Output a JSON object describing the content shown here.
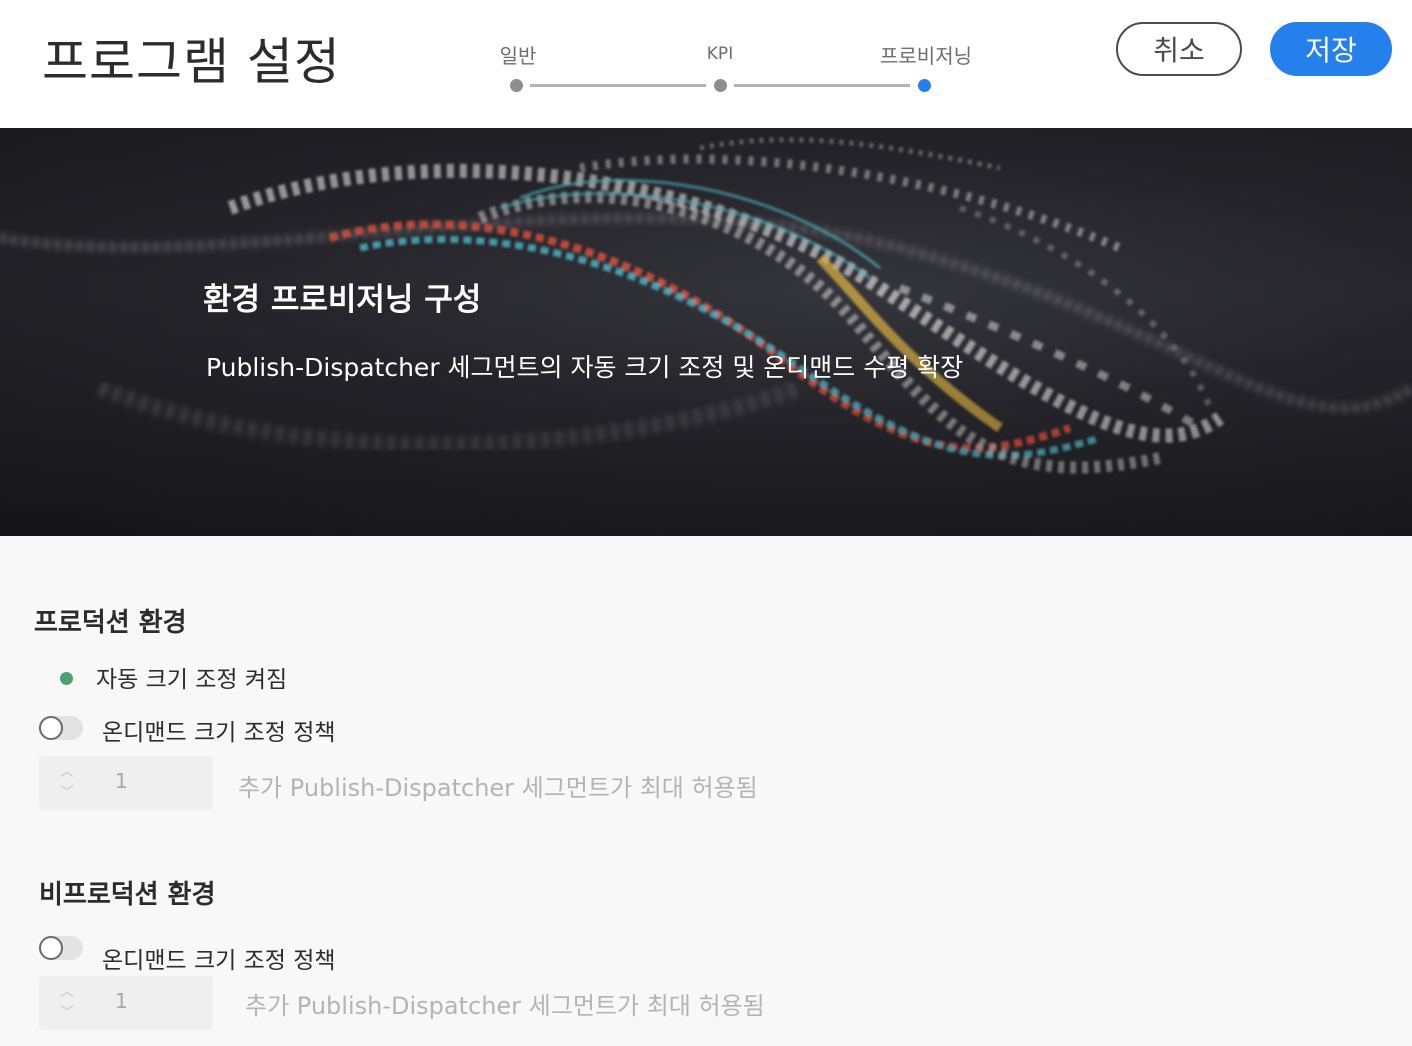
{
  "header": {
    "title": "프로그램 설정",
    "steps": [
      {
        "label": "일반",
        "state": "done"
      },
      {
        "label": "KPI",
        "state": "done"
      },
      {
        "label": "프로비저닝",
        "state": "current"
      }
    ],
    "cancel_label": "취소",
    "save_label": "저장",
    "accent_color": "#2680eb"
  },
  "hero": {
    "title": "환경 프로비저닝 구성",
    "subtitle": "Publish-Dispatcher 세그먼트의 자동 크기 조정 및 온디맨드 수평 확장"
  },
  "production": {
    "title": "프로덕션 환경",
    "autoscale_status": "자동 크기 조정 켜짐",
    "status_color": "#4aa174",
    "on_demand_toggle_label": "온디맨드 크기 조정 정책",
    "on_demand_enabled": false,
    "segments_value": "1",
    "segments_help": "추가 Publish-Dispatcher 세그먼트가 최대 허용됨"
  },
  "non_production": {
    "title": "비프로덕션 환경",
    "on_demand_toggle_label": "온디맨드 크기 조정 정책",
    "on_demand_enabled": false,
    "segments_value": "1",
    "segments_help": "추가 Publish-Dispatcher 세그먼트가 최대 허용됨"
  }
}
